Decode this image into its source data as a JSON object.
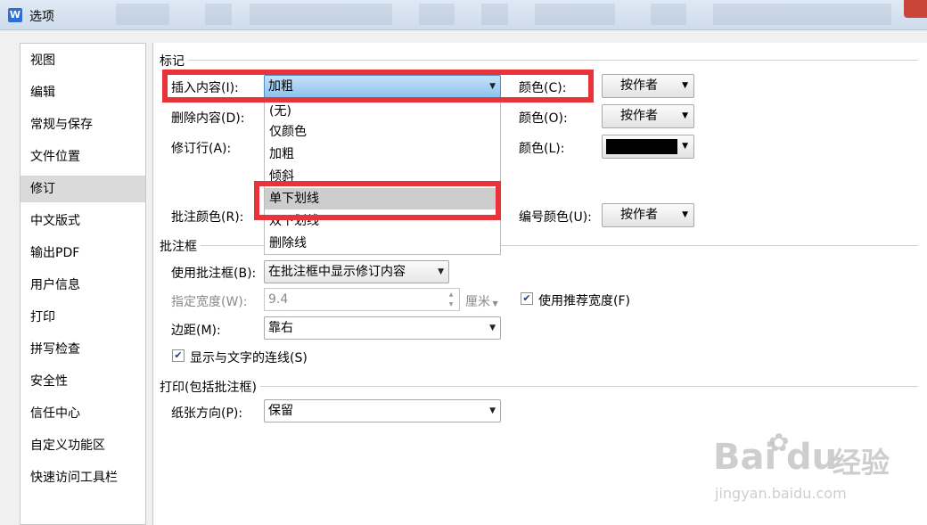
{
  "window": {
    "title": "选项",
    "app_icon": "W"
  },
  "sidebar": {
    "items": [
      {
        "label": "视图"
      },
      {
        "label": "编辑"
      },
      {
        "label": "常规与保存"
      },
      {
        "label": "文件位置"
      },
      {
        "label": "修订"
      },
      {
        "label": "中文版式"
      },
      {
        "label": "输出PDF"
      },
      {
        "label": "用户信息"
      },
      {
        "label": "打印"
      },
      {
        "label": "拼写检查"
      },
      {
        "label": "安全性"
      },
      {
        "label": "信任中心"
      },
      {
        "label": "自定义功能区"
      },
      {
        "label": "快速访问工具栏"
      }
    ],
    "selected": "修订"
  },
  "markup": {
    "group_title": "标记",
    "insert_label": "插入内容(I):",
    "insert_value": "加粗",
    "delete_label": "删除内容(D):",
    "revline_label": "修订行(A):",
    "comment_color_label": "批注颜色(R):",
    "color_c_label": "颜色(C):",
    "color_c_value": "按作者",
    "color_o_label": "颜色(O):",
    "color_o_value": "按作者",
    "color_l_label": "颜色(L):",
    "color_l_swatch": "#000000",
    "number_color_label": "编号颜色(U):",
    "number_color_value": "按作者"
  },
  "dropdown": {
    "options": [
      "(无)",
      "仅颜色",
      "加粗",
      "倾斜",
      "单下划线",
      "双下划线",
      "删除线"
    ],
    "highlighted": "单下划线"
  },
  "balloons": {
    "group_title": "批注框",
    "use_label": "使用批注框(B):",
    "use_value": "在批注框中显示修订内容",
    "width_label": "指定宽度(W):",
    "width_value": "9.4",
    "width_unit": "厘米",
    "recommended_label": "使用推荐宽度(F)",
    "recommended_checked": true,
    "margin_label": "边距(M):",
    "margin_value": "靠右",
    "lines_label": "显示与文字的连线(S)",
    "lines_checked": true
  },
  "printing": {
    "group_title": "打印(包括批注框)",
    "orientation_label": "纸张方向(P):",
    "orientation_value": "保留"
  },
  "watermark": {
    "brand": "Bai",
    "brand2": "du",
    "cn": "经验",
    "url": "jingyan.baidu.com"
  }
}
